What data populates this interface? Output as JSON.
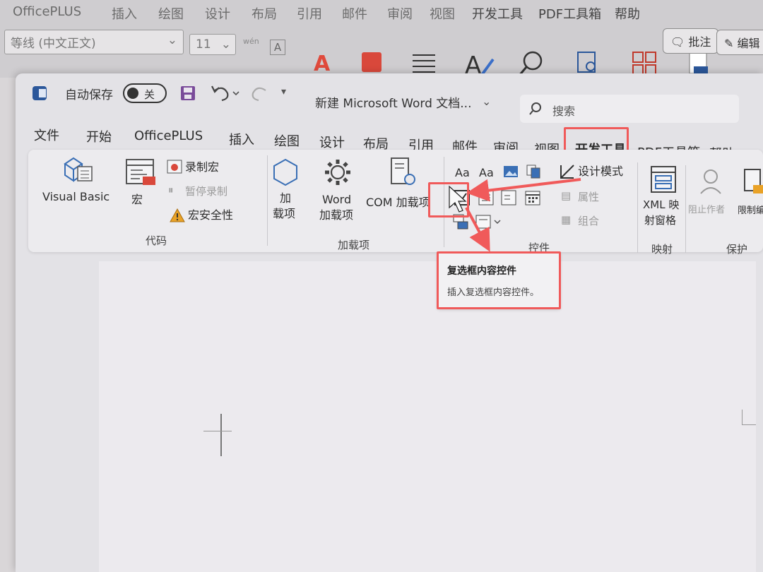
{
  "background_window": {
    "menu": [
      "OfficePLUS",
      "插入",
      "绘图",
      "设计",
      "布局",
      "引用",
      "邮件",
      "审阅",
      "视图",
      "开发工具",
      "PDF工具箱",
      "帮助"
    ],
    "font_name": "等线 (中文正文)",
    "font_size": "11",
    "wen_label": "wén",
    "a_box": "A",
    "comment_button": "批注",
    "edit_button": "编辑"
  },
  "window": {
    "app_icon": "word-app-icon",
    "autosave_label": "自动保存",
    "autosave_state": "关",
    "document_title": "新建 Microsoft Word 文档...",
    "search_placeholder": "搜索"
  },
  "tabs": [
    {
      "label": "文件",
      "active": false
    },
    {
      "label": "开始",
      "active": false
    },
    {
      "label": "OfficePLUS",
      "active": false
    },
    {
      "label": "插入",
      "active": false
    },
    {
      "label": "绘图",
      "active": false
    },
    {
      "label": "设计",
      "active": false
    },
    {
      "label": "布局",
      "active": false
    },
    {
      "label": "引用",
      "active": false
    },
    {
      "label": "邮件",
      "active": false
    },
    {
      "label": "审阅",
      "active": false
    },
    {
      "label": "视图",
      "active": false
    },
    {
      "label": "开发工具",
      "active": true
    },
    {
      "label": "PDF工具箱",
      "active": false
    },
    {
      "label": "帮助",
      "active": false
    }
  ],
  "ribbon": {
    "code": {
      "visual_basic": "Visual Basic",
      "macros": "宏",
      "record_macro": "录制宏",
      "pause_recording": "暂停录制",
      "macro_security": "宏安全性",
      "group_label": "代码"
    },
    "addins": {
      "addins_line1": "加",
      "addins_line2": "载项",
      "word_addins_line1": "Word",
      "word_addins_line2": "加载项",
      "com_addins": "COM 加载项",
      "group_label": "加载项"
    },
    "controls": {
      "rich_text": "Aa",
      "plain_text": "Aa",
      "design_mode": "设计模式",
      "properties": "属性",
      "group": "组合",
      "group_label": "控件"
    },
    "mapping": {
      "xml_line1": "XML 映",
      "xml_line2": "射窗格",
      "group_label": "映射"
    },
    "protect": {
      "block_authors": "阻止作者",
      "restrict_editing": "限制编辑",
      "group_label": "保护"
    }
  },
  "tooltip": {
    "title": "复选框内容控件",
    "description": "插入复选框内容控件。"
  },
  "colors": {
    "annotation_red": "#f05a5a",
    "active_tab_underline": "#2b579a",
    "word_blue": "#2b579a"
  }
}
